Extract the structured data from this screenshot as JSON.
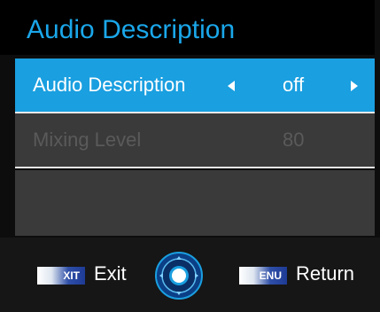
{
  "header": {
    "title": "Audio Description"
  },
  "menu": {
    "items": [
      {
        "label": "Audio Description",
        "value": "off"
      },
      {
        "label": "Mixing Level",
        "value": "80"
      }
    ]
  },
  "footer": {
    "exit_key": "XIT",
    "exit_label": "Exit",
    "menu_key": "ENU",
    "return_label": "Return"
  },
  "colors": {
    "accent": "#1a9fe0",
    "title": "#1aa7ea",
    "disabled_text": "#5a5a5a",
    "row_bg": "#3a3a3a"
  },
  "icons": [
    "arrow-left-icon",
    "arrow-right-icon",
    "dpad-ok-icon"
  ]
}
